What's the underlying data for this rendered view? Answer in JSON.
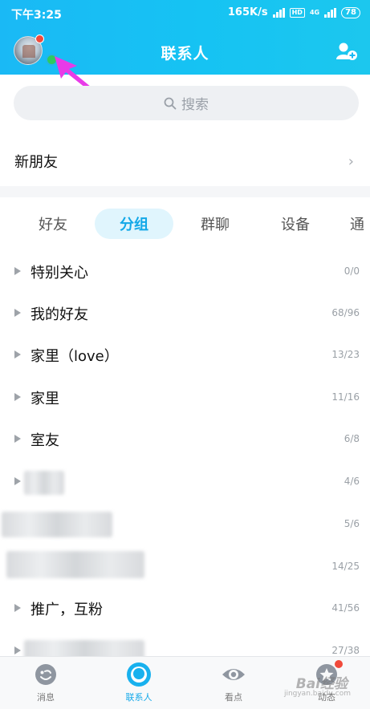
{
  "status_bar": {
    "time": "下午3:25",
    "net_speed": "165K/s",
    "hd": "HD",
    "net_type": "4G",
    "battery": "78"
  },
  "header": {
    "title": "联系人"
  },
  "search": {
    "placeholder": "搜索"
  },
  "new_friends": {
    "label": "新朋友"
  },
  "tabs": [
    {
      "label": "好友",
      "active": false
    },
    {
      "label": "分组",
      "active": true
    },
    {
      "label": "群聊",
      "active": false
    },
    {
      "label": "设备",
      "active": false
    },
    {
      "label": "通",
      "active": false
    }
  ],
  "groups": [
    {
      "name": "特别关心",
      "count": "0/0"
    },
    {
      "name": "我的好友",
      "count": "68/96"
    },
    {
      "name": "家里（love）",
      "count": "13/23"
    },
    {
      "name": "家里",
      "count": "11/16"
    },
    {
      "name": "室友",
      "count": "6/8"
    },
    {
      "name": "",
      "count": "4/6"
    },
    {
      "name": "",
      "count": "5/6"
    },
    {
      "name": "",
      "count": "14/25"
    },
    {
      "name": "推广，互粉",
      "count": "41/56"
    },
    {
      "name": "",
      "count": "27/38"
    }
  ],
  "bottom_nav": [
    {
      "label": "消息",
      "icon": "message-icon",
      "active": false
    },
    {
      "label": "联系人",
      "icon": "contacts-icon",
      "active": true
    },
    {
      "label": "看点",
      "icon": "eye-icon",
      "active": false
    },
    {
      "label": "动态",
      "icon": "star-icon",
      "active": false
    }
  ],
  "watermark": {
    "text": "Bai经验",
    "sub": "jingyan.baidu.com"
  },
  "colors": {
    "header": "#1ab9f5",
    "accent": "#12a8e8",
    "online": "#2fca5f",
    "badge": "#f14a3b",
    "annotation_arrow": "#e83be8"
  }
}
